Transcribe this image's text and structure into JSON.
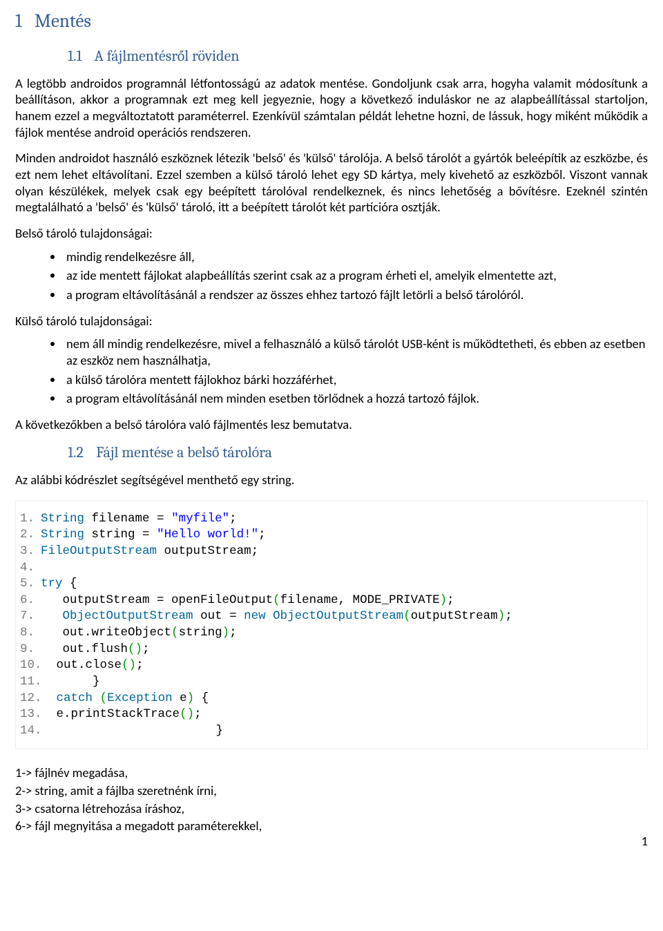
{
  "h1": {
    "num": "1",
    "text": "Mentés"
  },
  "h2a": {
    "num": "1.1",
    "text": "A fájlmentésről röviden"
  },
  "p1": "A legtöbb androidos programnál létfontosságú az adatok mentése. Gondoljunk csak arra, hogyha valamit módosítunk a beállításon, akkor a programnak ezt meg kell jegyeznie, hogy a következő induláskor ne az alapbeállítással startoljon, hanem ezzel a megváltoztatott paraméterrel. Ezenkívül számtalan példát lehetne hozni, de lássuk, hogy miként működik a fájlok mentése android operációs rendszeren.",
  "p2": "Minden androidot használó eszköznek létezik 'belső' és 'külső' tárolója. A belső tárolót a gyártók beleépítik az eszközbe, és ezt nem lehet eltávolítani. Ezzel szemben a külső tároló lehet egy SD kártya, mely kivehető az eszközből. Viszont vannak olyan készülékek, melyek csak egy beépített tárolóval rendelkeznek, és nincs lehetőség a bővítésre. Ezeknél szintén megtalálható a 'belső' és 'külső' tároló, itt a beépített tárolót két partícióra osztják.",
  "p3": "Belső tároló tulajdonságai:",
  "list1": [
    "mindig rendelkezésre áll,",
    "az ide mentett fájlokat alapbeállítás szerint csak az a program érheti el, amelyik elmentette azt,",
    "a program eltávolításánál a rendszer az összes ehhez tartozó fájlt letörli a belső tárolóról."
  ],
  "p4": "Külső tároló tulajdonságai:",
  "list2": [
    "nem áll mindig rendelkezésre, mivel a felhasználó a külső tárolót USB-ként is működtetheti, és ebben az esetben az eszköz nem használhatja,",
    "a külső tárolóra mentett fájlokhoz bárki hozzáférhet,",
    "a program eltávolításánál nem minden esetben törlődnek a hozzá tartozó fájlok."
  ],
  "p5": "A következőkben a belső tárolóra való fájlmentés lesz bemutatva.",
  "h2b": {
    "num": "1.2",
    "text": "Fájl mentése a belső tárolóra"
  },
  "p6": "Az alábbi kódrészlet segítségével menthető egy string.",
  "code": {
    "l1": {
      "n": "1.",
      "a": "String",
      "b": " filename = ",
      "c": "\"myfile\"",
      "d": ";"
    },
    "l2": {
      "n": "2.",
      "a": "String",
      "b": " string = ",
      "c": "\"Hello world!\"",
      "d": ";"
    },
    "l3": {
      "n": "3.",
      "a": "FileOutputStream",
      "b": " outputStream;"
    },
    "l4": {
      "n": "4."
    },
    "l5": {
      "n": "5.",
      "a": "try",
      "b": " {"
    },
    "l6": {
      "n": "6.",
      "a": "   outputStream = openFileOutput",
      "b": "(",
      "c": "filename, MODE_PRIVATE",
      "d": ")",
      "e": ";"
    },
    "l7": {
      "n": "7.",
      "a": "   ObjectOutputStream",
      "b": " out = ",
      "c": "new",
      "d": " ObjectOutputStream",
      "e": "(",
      "f": "outputStream",
      "g": ")",
      "h": ";"
    },
    "l8": {
      "n": "8.",
      "a": "   out.writeObject",
      "b": "(",
      "c": "string",
      "d": ")",
      "e": ";"
    },
    "l9": {
      "n": "9.",
      "a": "   out.flush",
      "b": "()",
      "c": ";"
    },
    "l10": {
      "n": "10.",
      "a": "  out.close",
      "b": "()",
      "c": ";"
    },
    "l11": {
      "n": "11.",
      "a": "       }"
    },
    "l12": {
      "n": "12.",
      "a": "  ",
      "b": "catch",
      "c": " (",
      "d": "Exception",
      "e": " e",
      "f": ")",
      "g": " {"
    },
    "l13": {
      "n": "13.",
      "a": "  e.printStackTrace",
      "b": "()",
      "c": ";"
    },
    "l14": {
      "n": "14.",
      "a": "                        }"
    }
  },
  "legend": [
    "1-> fájlnév megadása,",
    "2-> string, amit a fájlba szeretnénk írni,",
    "3-> csatorna létrehozása íráshoz,",
    "6-> fájl megnyitása a megadott paraméterekkel,"
  ],
  "pagenum": "1"
}
